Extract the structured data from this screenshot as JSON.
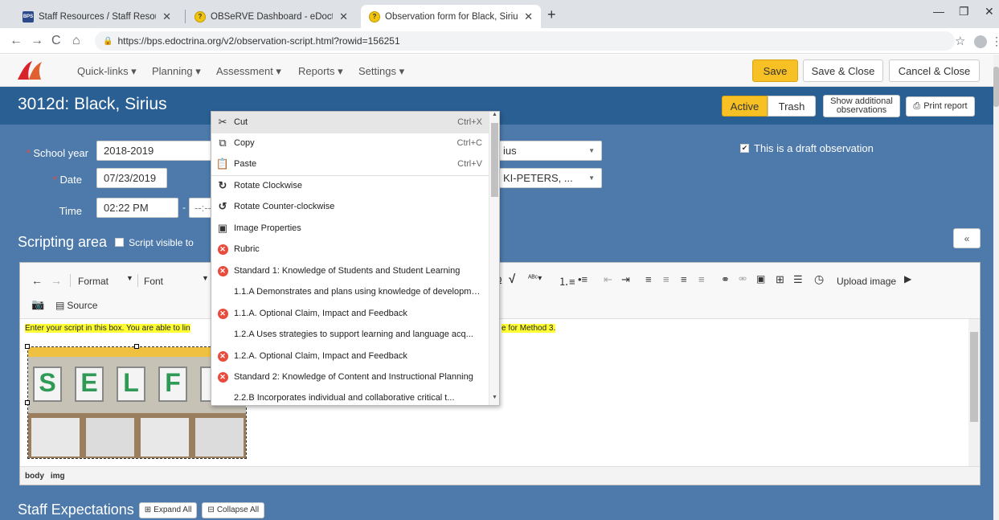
{
  "browser": {
    "tabs": [
      {
        "favicon": "BPS",
        "title": "Staff Resources / Staff Resources"
      },
      {
        "favicon": "?",
        "title": "OBSeRVE Dashboard - eDoctrina"
      },
      {
        "favicon": "?",
        "title": "Observation form for Black, Sirius"
      }
    ],
    "url": "https://bps.edoctrina.org/v2/observation-script.html?rowid=156251"
  },
  "appnav": {
    "menus": [
      "Quick-links ▾",
      "Planning ▾",
      "Assessment ▾",
      "Reports ▾",
      "Settings ▾"
    ],
    "save_label": "Save",
    "save_close_label": "Save & Close",
    "cancel_close_label": "Cancel & Close"
  },
  "header": {
    "title": "3012d: Black, Sirius",
    "active_label": "Active",
    "trash_label": "Trash",
    "show_additional_line1": "Show additional",
    "show_additional_line2": "observations",
    "print_label": "Print report"
  },
  "form": {
    "school_year_label": "School year",
    "school_year_value": "2018-2019",
    "date_label": "Date",
    "date_value": "07/23/2019",
    "time_label": "Time",
    "time_value": "02:22 PM",
    "time_end_placeholder": "--:--",
    "select1_value": "ius",
    "select2_value": "KI-PETERS, ...",
    "draft_label": "This is a draft observation"
  },
  "scripting": {
    "title": "Scripting area",
    "visible_label": "Script visible to",
    "collapse_label": "«"
  },
  "editor": {
    "format_label": "Format",
    "font_label": "Font",
    "source_label": "Source",
    "upload_label": "Upload image",
    "placeholder_start": "Enter your script in this box.  You are able to lin",
    "placeholder_end": "e for Method 3.",
    "status_items": [
      "body",
      "img"
    ],
    "photo_letters": [
      "S",
      "E",
      "L",
      "F",
      "I"
    ]
  },
  "staff": {
    "title": "Staff Expectations",
    "expand_label": "Expand All",
    "collapse_label": "Collapse All"
  },
  "context_menu": {
    "items": [
      {
        "icon": "scissors-icon",
        "label": "Cut",
        "shortcut": "Ctrl+X"
      },
      {
        "icon": "copy-icon",
        "label": "Copy",
        "shortcut": "Ctrl+C"
      },
      {
        "icon": "paste-icon",
        "label": "Paste",
        "shortcut": "Ctrl+V"
      },
      {
        "icon": "rotate-cw-icon",
        "label": "Rotate Clockwise",
        "shortcut": ""
      },
      {
        "icon": "rotate-ccw-icon",
        "label": "Rotate Counter-clockwise",
        "shortcut": ""
      },
      {
        "icon": "image-icon",
        "label": "Image Properties",
        "shortcut": ""
      },
      {
        "icon": "rubric-icon",
        "label": "Rubric",
        "shortcut": ""
      },
      {
        "icon": "rubric-icon",
        "label": "Standard 1: Knowledge of Students and Student Learning",
        "shortcut": ""
      },
      {
        "icon": "",
        "label": "1.1.A Demonstrates and plans using knowledge of developmen...",
        "shortcut": ""
      },
      {
        "icon": "rubric-icon",
        "label": "1.1.A. Optional Claim, Impact and Feedback",
        "shortcut": ""
      },
      {
        "icon": "",
        "label": "1.2.A Uses strategies to support learning and language acq...",
        "shortcut": ""
      },
      {
        "icon": "rubric-icon",
        "label": "1.2.A. Optional Claim, Impact and Feedback",
        "shortcut": ""
      },
      {
        "icon": "rubric-icon",
        "label": "Standard 2: Knowledge of Content and Instructional Planning",
        "shortcut": ""
      },
      {
        "icon": "",
        "label": "2.2.B Incorporates individual and collaborative critical t...",
        "shortcut": ""
      }
    ]
  }
}
